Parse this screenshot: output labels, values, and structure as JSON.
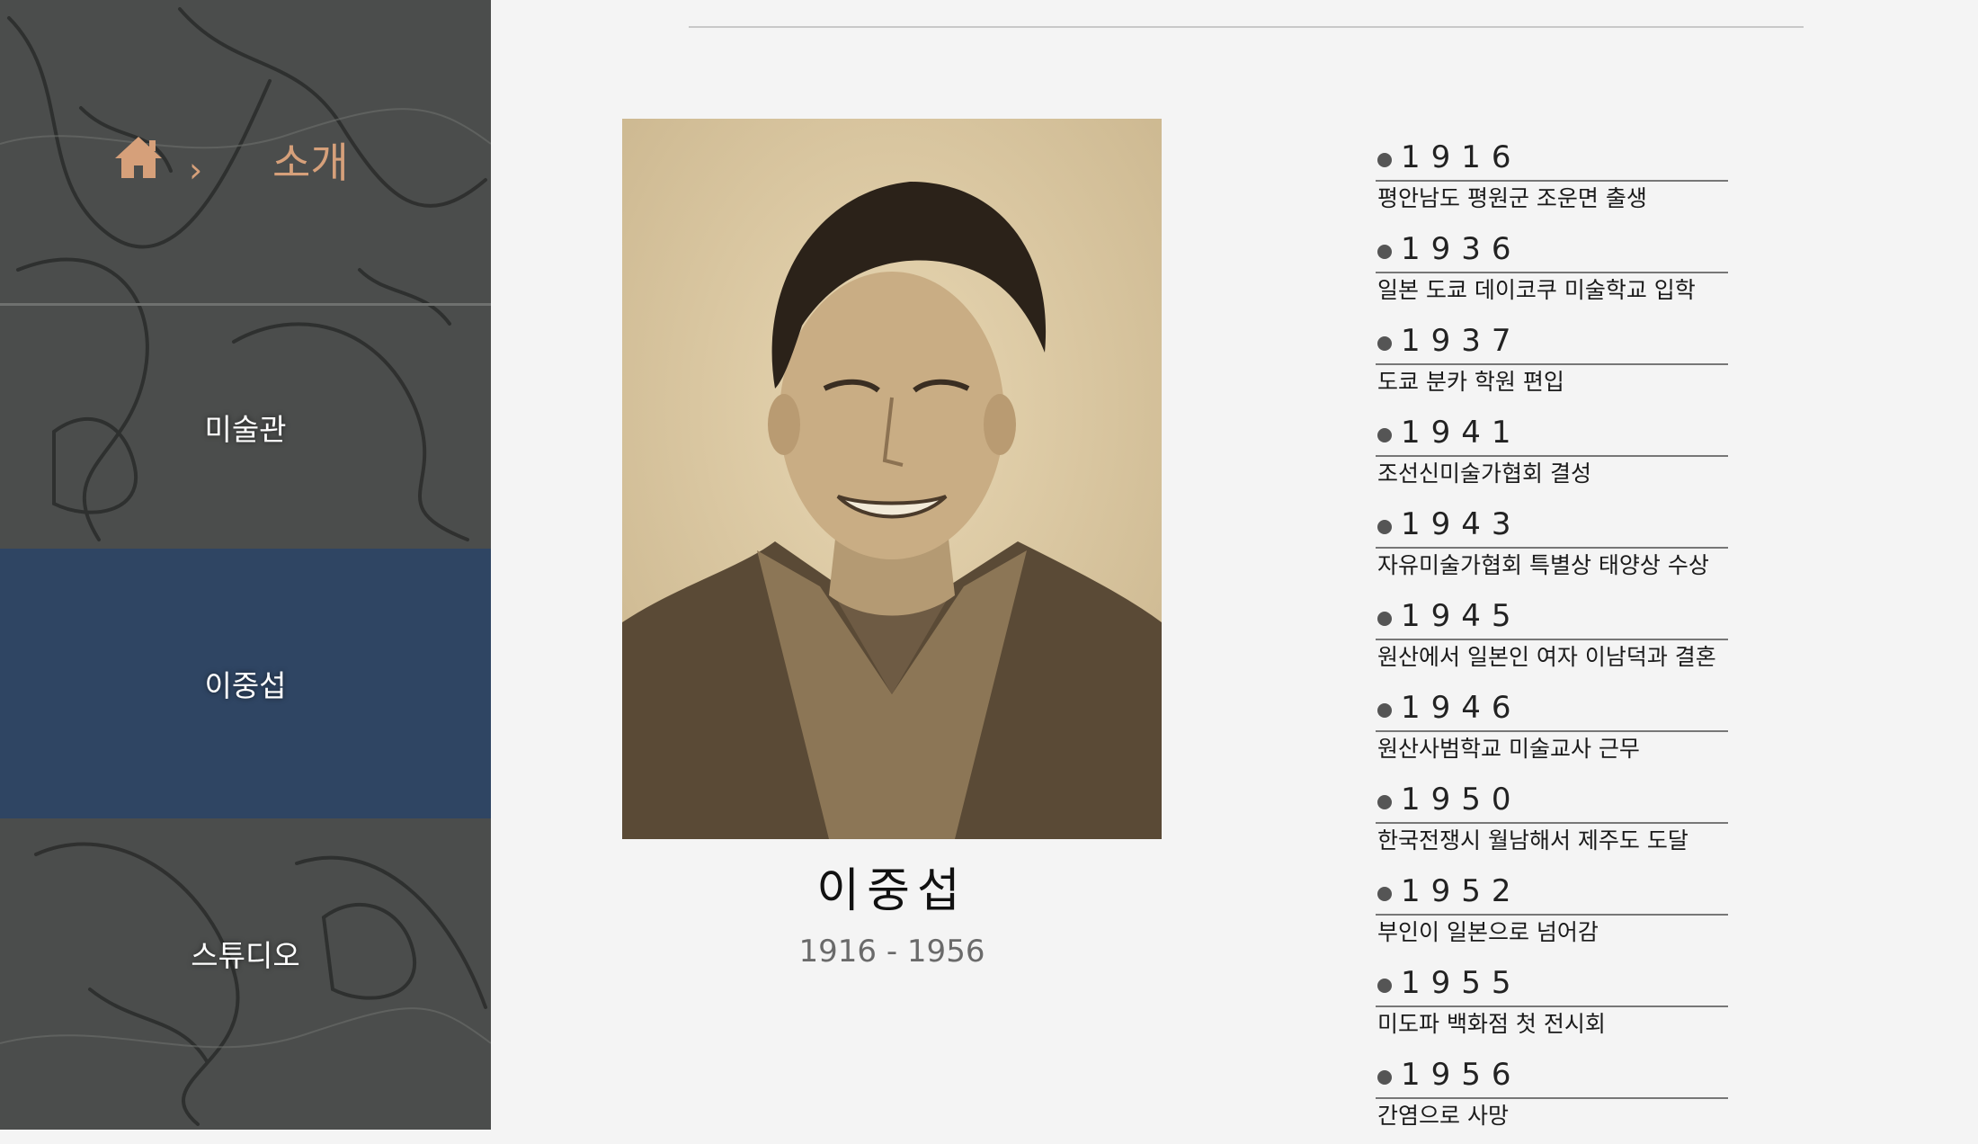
{
  "breadcrumb": {
    "home_icon": "home-icon",
    "separator": "›",
    "current": "소개"
  },
  "sidebar": {
    "items": [
      {
        "label": "미술관",
        "active": false
      },
      {
        "label": "이중섭",
        "active": true
      },
      {
        "label": "스튜디오",
        "active": false
      }
    ]
  },
  "artist": {
    "name": "이중섭",
    "dates": "1916 - 1956"
  },
  "timeline": [
    {
      "year": "1916",
      "event": "평안남도 평원군 조운면 출생"
    },
    {
      "year": "1936",
      "event": "일본 도쿄 데이코쿠 미술학교 입학"
    },
    {
      "year": "1937",
      "event": "도쿄 분카 학원 편입"
    },
    {
      "year": "1941",
      "event": "조선신미술가협회 결성"
    },
    {
      "year": "1943",
      "event": "자유미술가협회 특별상 태양상 수상"
    },
    {
      "year": "1945",
      "event": "원산에서 일본인 여자 이남덕과 결혼"
    },
    {
      "year": "1946",
      "event": "원산사범학교 미술교사 근무"
    },
    {
      "year": "1950",
      "event": "한국전쟁시 월남해서 제주도 도달"
    },
    {
      "year": "1952",
      "event": "부인이 일본으로 넘어감"
    },
    {
      "year": "1955",
      "event": "미도파 백화점 첫 전시회"
    },
    {
      "year": "1956",
      "event": "간염으로 사망"
    }
  ],
  "colors": {
    "accent": "#d6a07a",
    "active_nav": "#2f4563",
    "sidebar_bg": "#4b4d4c",
    "page_bg": "#f4f4f4"
  }
}
